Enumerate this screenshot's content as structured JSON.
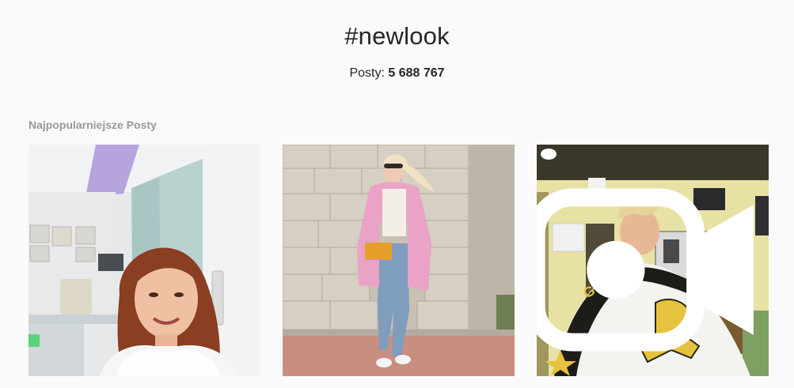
{
  "header": {
    "hashtag": "#newlook",
    "posts_label": "Posty:",
    "posts_count": "5 688 767"
  },
  "section": {
    "title": "Najpopularniejsze Posty"
  },
  "posts": [
    {
      "type": "photo",
      "subject": "woman-selfie-office"
    },
    {
      "type": "photo",
      "subject": "woman-pink-coat-street"
    },
    {
      "type": "video",
      "subject": "boy-barbershop-cape",
      "icon": "video-icon"
    }
  ],
  "colors": {
    "background": "#fafafa",
    "text": "#262626",
    "muted": "#999999"
  }
}
